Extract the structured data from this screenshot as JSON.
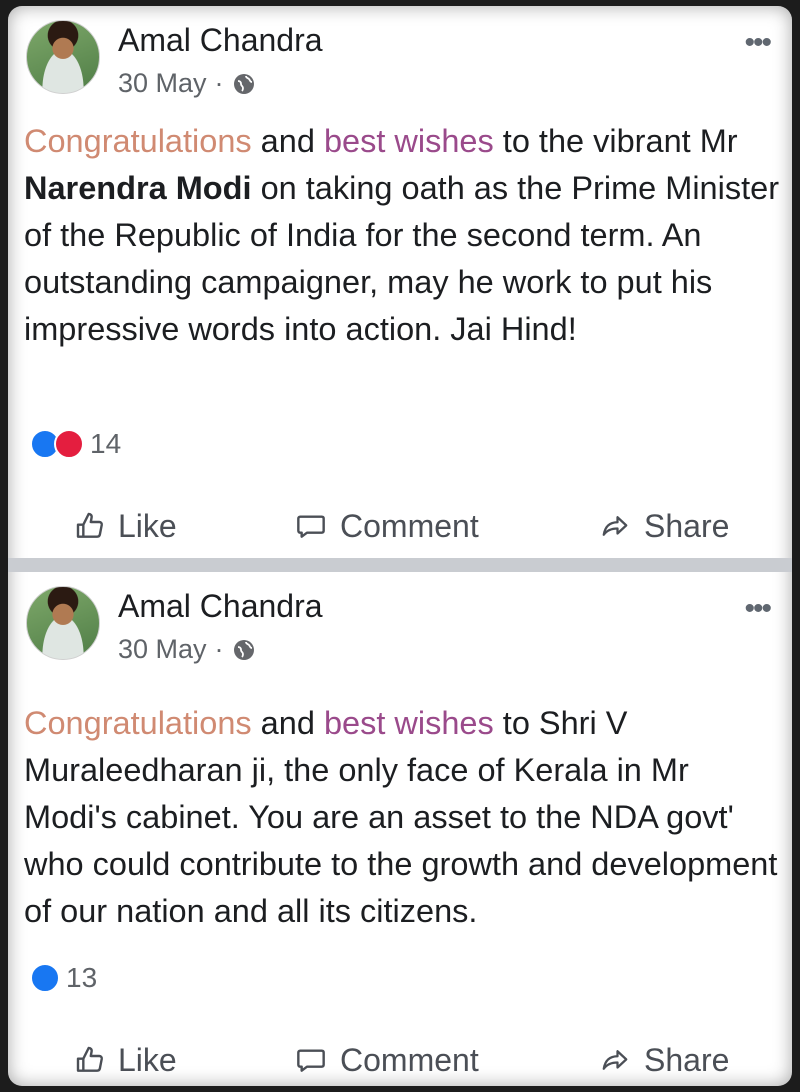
{
  "posts": [
    {
      "author": "Amal Chandra",
      "date": "30 May",
      "separator": "·",
      "text_parts": [
        {
          "text": "Congratulations",
          "style": "hl-orange"
        },
        {
          "text": " and ",
          "style": ""
        },
        {
          "text": "best wishes",
          "style": "hl-purple"
        },
        {
          "text": " to the vibrant Mr ",
          "style": ""
        },
        {
          "text": "Narendra Modi",
          "style": "bold"
        },
        {
          "text": " on taking oath as the Prime Minister of the Republic of India for the second term. An outstanding campaigner, may he work to put his impressive words into action. Jai Hind!",
          "style": ""
        }
      ],
      "reactions": [
        "like",
        "love"
      ],
      "reaction_count": "14"
    },
    {
      "author": "Amal Chandra",
      "date": "30 May",
      "separator": "·",
      "text_parts": [
        {
          "text": "Congratulations",
          "style": "hl-orange"
        },
        {
          "text": " and ",
          "style": ""
        },
        {
          "text": "best wishes",
          "style": "hl-purple"
        },
        {
          "text": " to Shri V Muraleedharan ji, the only face of Kerala in Mr Modi's cabinet. You are an asset to the NDA govt' who could contribute to the growth and development of our nation and all its citizens.",
          "style": ""
        }
      ],
      "reactions": [
        "like"
      ],
      "reaction_count": "13"
    }
  ],
  "actions": {
    "like": "Like",
    "comment": "Comment",
    "share": "Share"
  },
  "icons": {
    "more": "more-options-icon",
    "privacy": "globe-icon",
    "like": "thumbs-up-icon",
    "comment": "comment-bubble-icon",
    "share": "share-arrow-icon"
  },
  "colors": {
    "highlight_orange": "#d08a72",
    "highlight_purple": "#9a4a8b",
    "like_blue": "#1877f2",
    "love_red": "#e41e3f"
  }
}
